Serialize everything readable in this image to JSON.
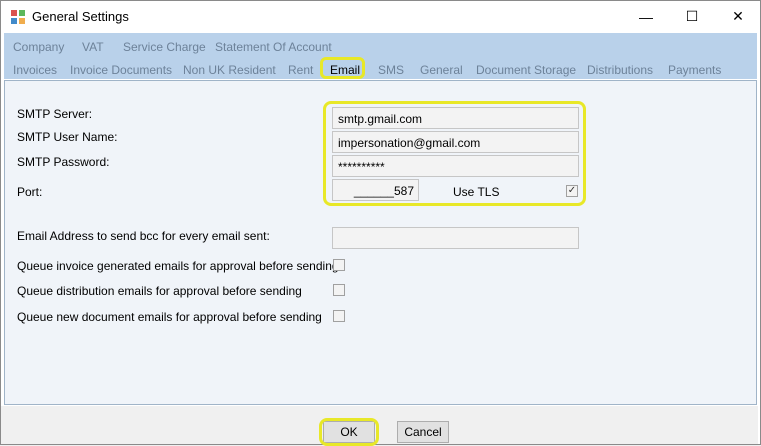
{
  "window": {
    "title": "General Settings",
    "minimize": "—",
    "maximize": "☐",
    "close": "✕"
  },
  "tabs_row1": [
    "Company",
    "VAT",
    "Service Charge",
    "Statement Of Account"
  ],
  "tabs_row2": [
    "Invoices",
    "Invoice Documents",
    "Non UK Resident",
    "Rent",
    "Email",
    "SMS",
    "General",
    "Document Storage",
    "Distributions",
    "Payments"
  ],
  "active_tab": "Email",
  "email": {
    "smtp_server_label": "SMTP Server:",
    "smtp_server_value": "smtp.gmail.com",
    "smtp_user_label": "SMTP User Name:",
    "smtp_user_value": "impersonation@gmail.com",
    "smtp_password_label": "SMTP Password:",
    "smtp_password_value": "**********",
    "port_label": "Port:",
    "port_value": "______587",
    "use_tls_label": "Use TLS",
    "use_tls_checked": "✓",
    "bcc_label": "Email Address to send bcc for every email sent:",
    "bcc_value": "",
    "queue_invoice_label": "Queue invoice generated emails for approval before sending",
    "queue_distribution_label": "Queue distribution emails for approval before sending",
    "queue_document_label": "Queue new document emails for approval before sending"
  },
  "buttons": {
    "ok": "OK",
    "cancel": "Cancel"
  },
  "colors": {
    "highlight": "#e8e828",
    "tabstrip": "#b9d1ea",
    "inactive_tab_text": "#6d8299"
  }
}
